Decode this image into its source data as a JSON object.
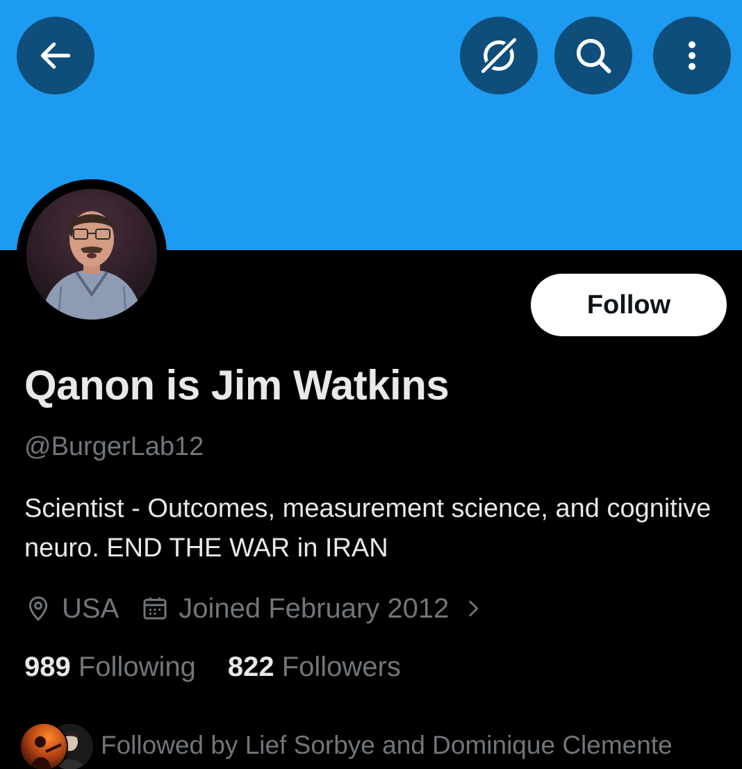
{
  "header": {
    "back_icon": "arrow-left-icon",
    "grok_icon": "grok-icon",
    "search_icon": "search-icon",
    "more_icon": "more-vertical-icon",
    "banner_color": "#1d9bf0",
    "button_color": "#0f4e7b"
  },
  "profile": {
    "display_name": "Qanon is Jim Watkins",
    "handle": "@BurgerLab12",
    "bio": "Scientist - Outcomes, measurement science, and cognitive neuro. END THE WAR in IRAN",
    "location": "USA",
    "joined": "Joined February 2012",
    "follow_label": "Follow"
  },
  "stats": {
    "following_count": "989",
    "following_label": "Following",
    "followers_count": "822",
    "followers_label": "Followers"
  },
  "followed_by": {
    "text": "Followed by Lief Sorbye and Dominique Clemente"
  },
  "icons": {
    "location": "location-pin-icon",
    "calendar": "calendar-icon",
    "chevron": "chevron-right-icon"
  },
  "colors": {
    "text_primary": "#e7e9ea",
    "text_secondary": "#71767b",
    "background": "#000000"
  }
}
